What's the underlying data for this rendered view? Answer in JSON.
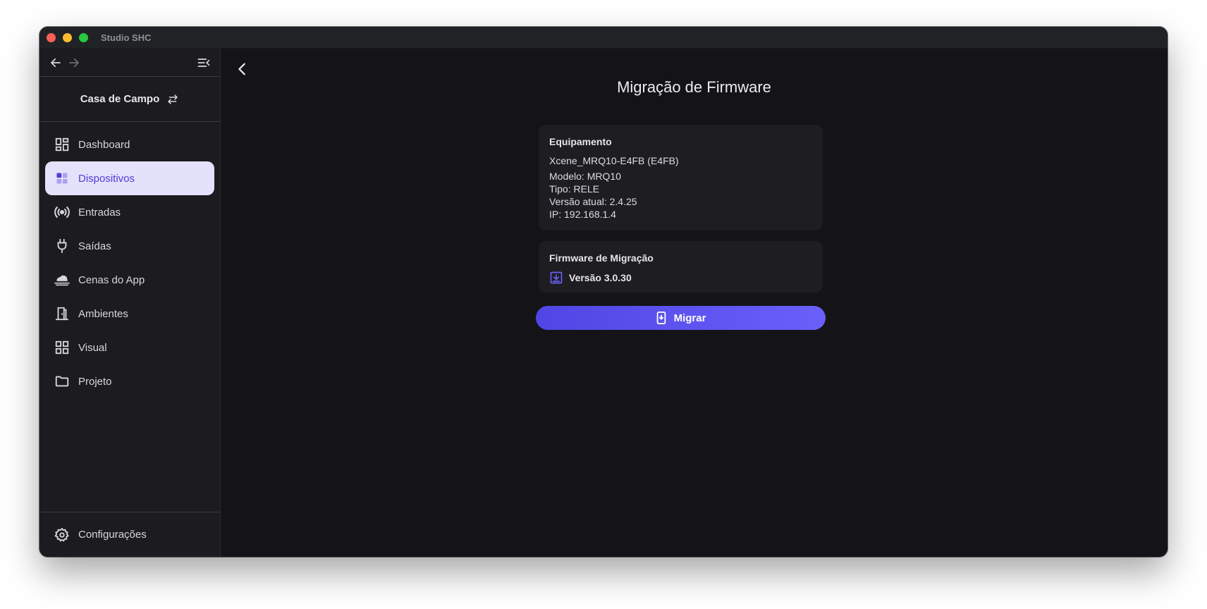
{
  "window": {
    "title": "Studio SHC"
  },
  "sidebar": {
    "project_name": "Casa de Campo",
    "items": [
      {
        "label": "Dashboard",
        "icon": "dashboard-icon",
        "active": false
      },
      {
        "label": "Dispositivos",
        "icon": "devices-icon",
        "active": true
      },
      {
        "label": "Entradas",
        "icon": "broadcast-icon",
        "active": false
      },
      {
        "label": "Saídas",
        "icon": "plug-icon",
        "active": false
      },
      {
        "label": "Cenas do App",
        "icon": "cloud-icon",
        "active": false
      },
      {
        "label": "Ambientes",
        "icon": "door-icon",
        "active": false
      },
      {
        "label": "Visual",
        "icon": "grid-icon",
        "active": false
      },
      {
        "label": "Projeto",
        "icon": "folder-icon",
        "active": false
      }
    ],
    "settings_label": "Configurações"
  },
  "main": {
    "title": "Migração de Firmware",
    "equipment": {
      "heading": "Equipamento",
      "name": "Xcene_MRQ10-E4FB (E4FB)",
      "model": "Modelo: MRQ10",
      "type": "Tipo: RELE",
      "version": "Versão atual: 2.4.25",
      "ip": "IP: 192.168.1.4"
    },
    "firmware": {
      "heading": "Firmware de Migração",
      "version": "Versão 3.0.30"
    },
    "migrate_label": "Migrar"
  },
  "colors": {
    "accent": "#5b50ee",
    "active_bg": "#e4e1fb",
    "active_text": "#4b3fd4"
  }
}
